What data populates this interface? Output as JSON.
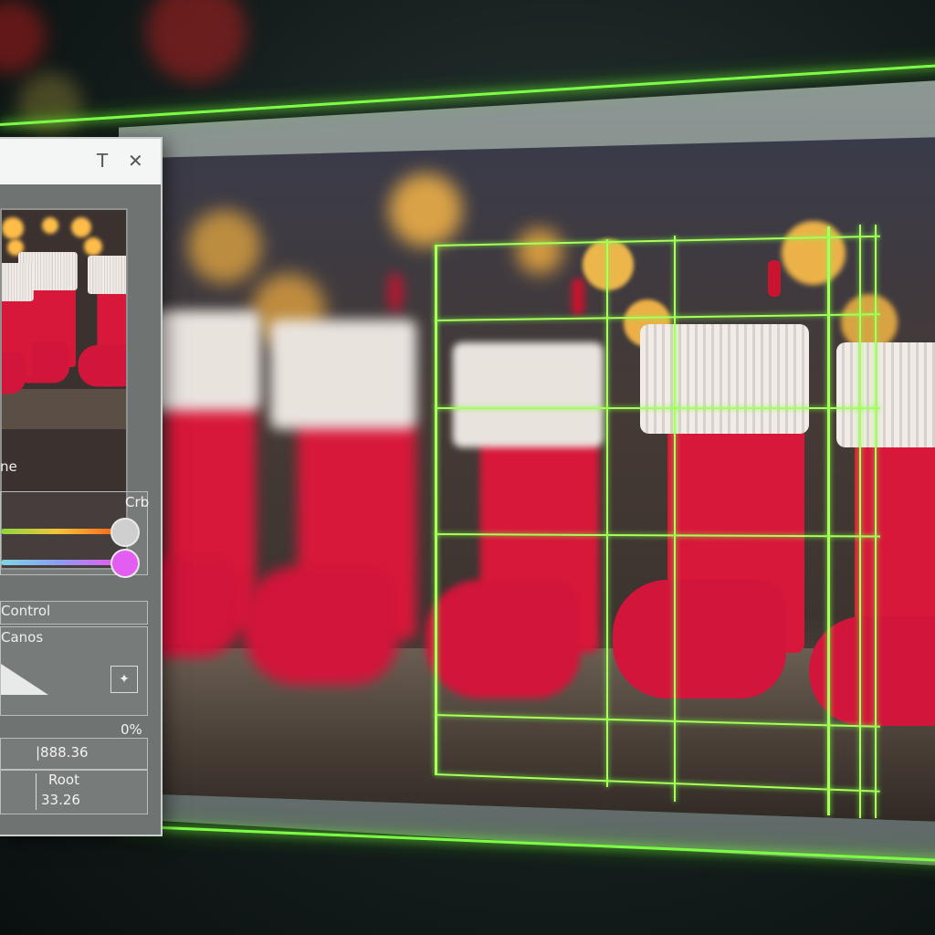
{
  "panel": {
    "titlebar": {
      "text_button": "T",
      "close_button": "✕"
    },
    "section_label": "ne",
    "crop_label": "Crb",
    "control_label": "Control",
    "canvas_label": "Canos",
    "percent_value": "0%",
    "coord_value": "|888.36",
    "root_label": "Root",
    "root_value": "33.26",
    "slider_colors": {
      "top": "#ff6a1a",
      "bottom": "#e35df2"
    }
  },
  "colors": {
    "accent_glow": "#7dff45",
    "stocking_red": "#d8183a"
  }
}
